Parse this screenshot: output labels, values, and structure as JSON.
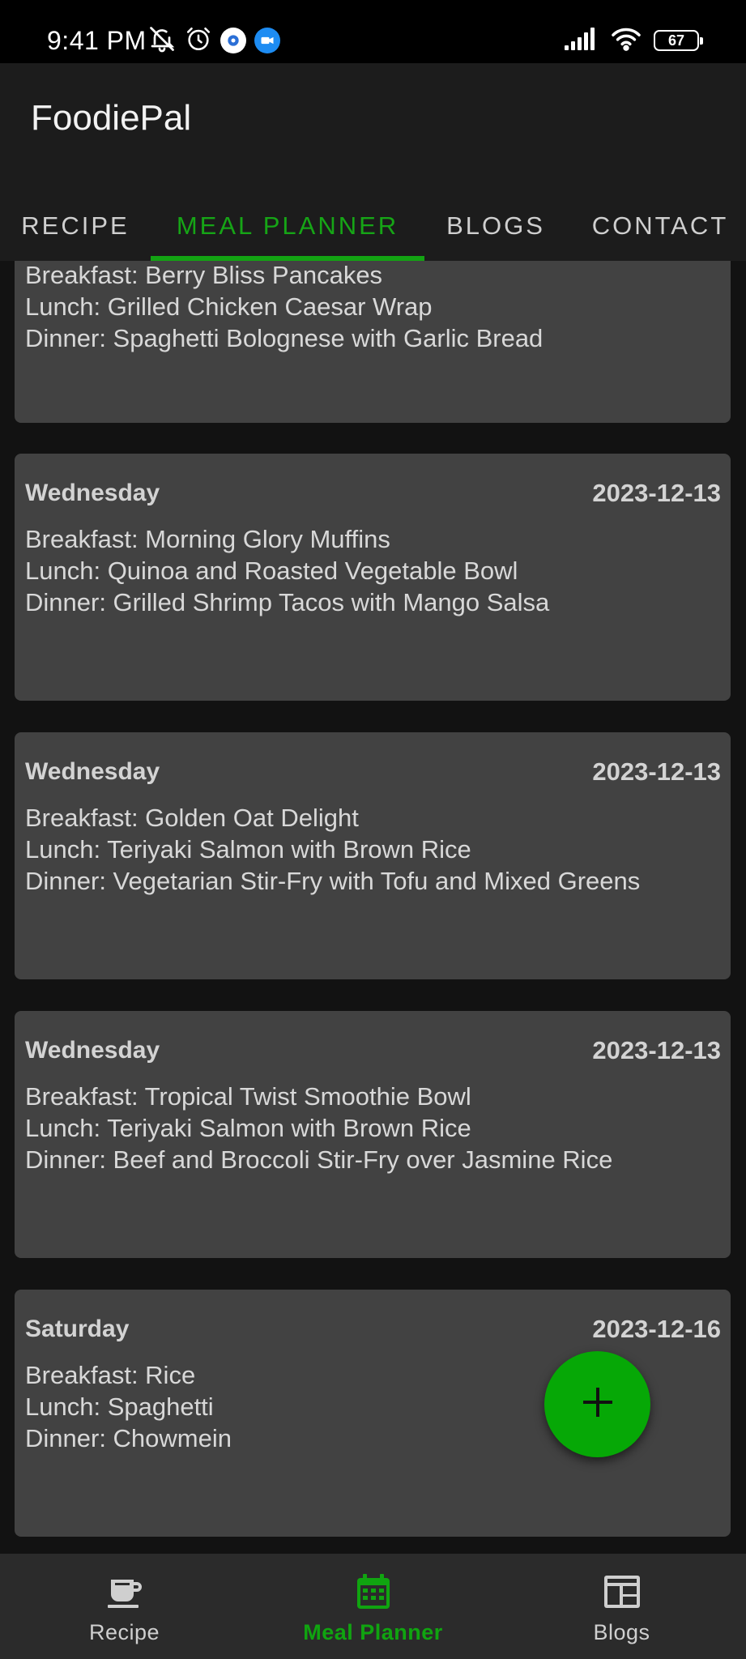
{
  "status_bar": {
    "time": "9:41 PM",
    "battery": "67",
    "icons": [
      "mute-bell-icon",
      "alarm-icon",
      "app-notification-icon",
      "video-call-icon",
      "signal-icon",
      "wifi-icon",
      "battery-icon"
    ]
  },
  "app": {
    "title": "FoodiePal"
  },
  "tabs": [
    {
      "label": "RECIPE"
    },
    {
      "label": "MEAL PLANNER"
    },
    {
      "label": "BLOGS"
    },
    {
      "label": "CONTACT"
    }
  ],
  "active_tab": "MEAL PLANNER",
  "meal_plans": [
    {
      "day": "",
      "date": "",
      "breakfast": "Breakfast: Berry Bliss Pancakes",
      "lunch": "Lunch: Grilled Chicken Caesar Wrap",
      "dinner": "Dinner: Spaghetti Bolognese with Garlic Bread"
    },
    {
      "day": "Wednesday",
      "date": "2023-12-13",
      "breakfast": "Breakfast: Morning Glory Muffins",
      "lunch": "Lunch: Quinoa and Roasted Vegetable Bowl",
      "dinner": "Dinner: Grilled Shrimp Tacos with Mango Salsa"
    },
    {
      "day": "Wednesday",
      "date": "2023-12-13",
      "breakfast": "Breakfast: Golden Oat Delight",
      "lunch": "Lunch: Teriyaki Salmon with Brown Rice",
      "dinner": "Dinner: Vegetarian Stir-Fry with Tofu and Mixed Greens"
    },
    {
      "day": "Wednesday",
      "date": "2023-12-13",
      "breakfast": "Breakfast: Tropical Twist Smoothie Bowl",
      "lunch": "Lunch: Teriyaki Salmon with Brown Rice",
      "dinner": "Dinner: Beef and Broccoli Stir-Fry over Jasmine Rice"
    },
    {
      "day": "Saturday",
      "date": "2023-12-16",
      "breakfast": "Breakfast: Rice",
      "lunch": "Lunch: Spaghetti",
      "dinner": "Dinner: Chowmein"
    }
  ],
  "fab": {
    "icon": "plus-icon"
  },
  "bottom_nav": [
    {
      "label": "Recipe",
      "icon": "coffee-cup-icon"
    },
    {
      "label": "Meal Planner",
      "icon": "calendar-icon"
    },
    {
      "label": "Blogs",
      "icon": "newspaper-icon"
    }
  ],
  "active_nav": "Meal Planner",
  "colors": {
    "accent": "#13a313",
    "fab": "#06a806",
    "card": "#424242",
    "background": "#121212",
    "app_bar": "#1c1c1c",
    "bottom_nav": "#2b2b2b"
  }
}
